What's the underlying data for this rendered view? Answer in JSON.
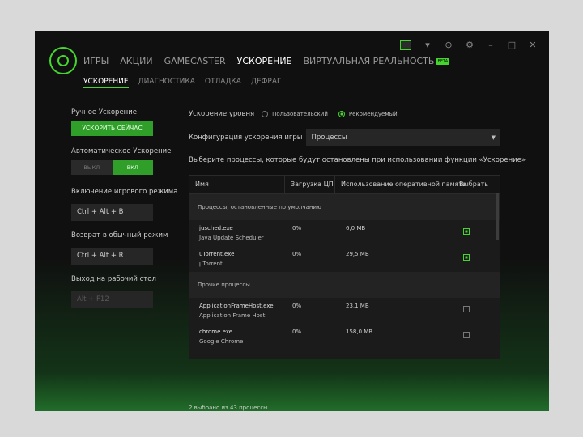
{
  "nav": {
    "tabs": [
      {
        "label": "ИГРЫ"
      },
      {
        "label": "АКЦИИ"
      },
      {
        "label": "GAMECASTER"
      },
      {
        "label": "УСКОРЕНИЕ"
      },
      {
        "label": "ВИРТУАЛЬНАЯ РЕАЛЬНОСТЬ",
        "badge": "BETA"
      }
    ],
    "active_tab": "УСКОРЕНИЕ",
    "subtabs": [
      {
        "label": "УСКОРЕНИЕ"
      },
      {
        "label": "ДИАГНОСТИКА"
      },
      {
        "label": "ОТЛАДКА"
      },
      {
        "label": "ДЕФРАГ"
      }
    ],
    "active_subtab": "УСКОРЕНИЕ"
  },
  "window_controls": {
    "icons": [
      "avatar-icon",
      "chevron-down-icon",
      "help-icon",
      "gear-icon",
      "minimize-icon",
      "maximize-icon",
      "close-icon"
    ]
  },
  "left": {
    "manual_label": "Ручное Ускорение",
    "boost_now_button": "УСКОРИТЬ СЕЙЧАС",
    "auto_label": "Автоматическое Ускорение",
    "toggle_off": "ВЫКЛ",
    "toggle_on": "ВКЛ",
    "game_mode_label": "Включение игрового режима",
    "game_mode_keys": "Ctrl + Alt + B",
    "normal_mode_label": "Возврат в обычный режим",
    "normal_mode_keys": "Ctrl + Alt + R",
    "desktop_label": "Выход на рабочий стол",
    "desktop_keys": "Alt + F12"
  },
  "right": {
    "level_label": "Ускорение уровня",
    "level_custom": "Пользовательский",
    "level_recommended": "Рекомендуемый",
    "config_label": "Конфигурация ускорения игры",
    "config_value": "Процессы",
    "hint": "Выберите процессы, которые будут остановлены при использовании функции «Ускорение»",
    "table": {
      "headers": {
        "name": "Имя",
        "cpu": "Загрузка ЦП",
        "mem": "Использование оперативной памяти",
        "select": "Выбрать"
      },
      "section_default": "Процессы, остановленные по умолчанию",
      "default_rows": [
        {
          "name": "jusched.exe",
          "desc": "Java Update Scheduler",
          "cpu": "0%",
          "mem": "6,0 MB",
          "checked": true
        },
        {
          "name": "uTorrent.exe",
          "desc": "µTorrent",
          "cpu": "0%",
          "mem": "29,5 MB",
          "checked": true
        }
      ],
      "section_other": "Прочие процессы",
      "other_rows": [
        {
          "name": "ApplicationFrameHost.exe",
          "desc": "Application Frame Host",
          "cpu": "0%",
          "mem": "23,1 MB",
          "checked": false
        },
        {
          "name": "chrome.exe",
          "desc": "Google Chrome",
          "cpu": "0%",
          "mem": "158,0 MB",
          "checked": false
        }
      ]
    },
    "footer": "2 выбрано из 43 процессы"
  },
  "colors": {
    "accent": "#44d62c",
    "button_green": "#2f9f2a",
    "background": "#101010"
  }
}
